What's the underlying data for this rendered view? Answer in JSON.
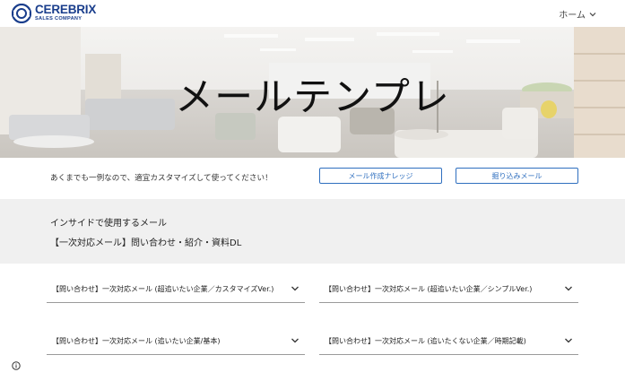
{
  "header": {
    "logo_name": "CEREBRIX",
    "logo_sub": "SALES COMPANY",
    "nav_home": "ホーム"
  },
  "hero": {
    "title": "メールテンプレ"
  },
  "intro": {
    "text": "あくまでも一例なので、適宜カスタマイズして使ってください！",
    "button_knowledge": "メール作成ナレッジ",
    "button_followup": "掘り込みメール"
  },
  "section": {
    "heading": "インサイドで使用するメール",
    "subheading": "【一次対応メール】問い合わせ・紹介・資料DL"
  },
  "accordions": [
    {
      "label": "【問い合わせ】一次対応メール (超追いたい企業／カスタマイズVer.)"
    },
    {
      "label": "【問い合わせ】一次対応メール (超追いたい企業／シンプルVer.)"
    },
    {
      "label": "【問い合わせ】一次対応メール (追いたい企業/基本)"
    },
    {
      "label": "【問い合わせ】一次対応メール (追いたくない企業／時期記載)"
    }
  ],
  "colors": {
    "brand": "#1a3e8c",
    "accent": "#2f6fbf",
    "section_bg": "#f0f0f0"
  },
  "icons": {
    "nav": "chevron-down-icon",
    "info": "info-icon"
  }
}
